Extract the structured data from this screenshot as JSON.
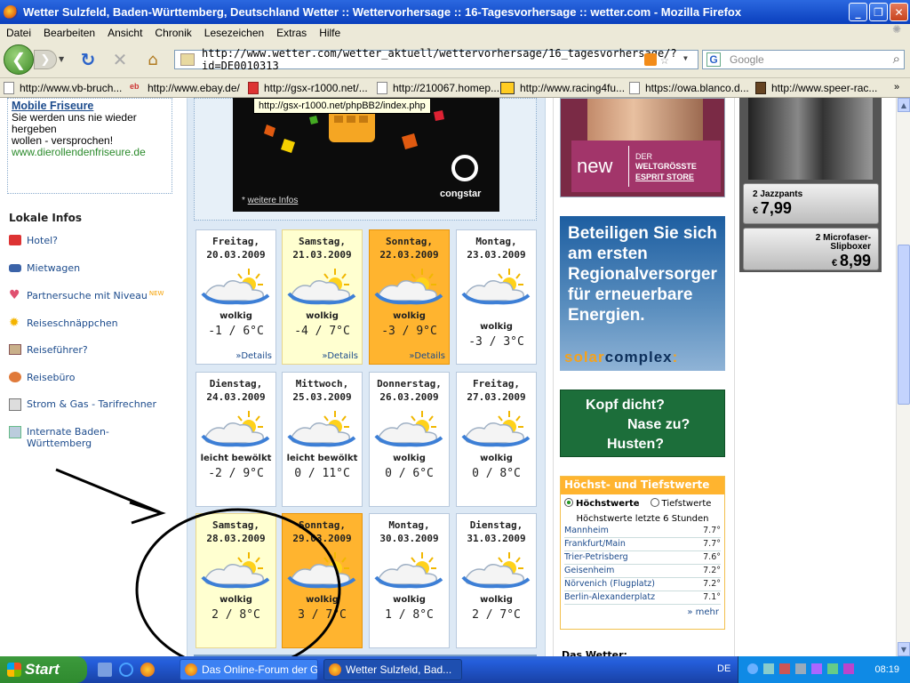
{
  "window": {
    "title": "Wetter Sulzfeld, Baden-Württemberg, Deutschland Wetter :: Wettervorhersage :: 16-Tagesvorhersage :: wetter.com - Mozilla Firefox"
  },
  "menu": [
    "Datei",
    "Bearbeiten",
    "Ansicht",
    "Chronik",
    "Lesezeichen",
    "Extras",
    "Hilfe"
  ],
  "nav": {
    "url": "http://www.wetter.com/wetter_aktuell/wettervorhersage/16_tagesvorhersage/?id=DE0010313",
    "search_placeholder": "Google"
  },
  "bookmarks": [
    "http://www.vb-bruch...",
    "http://www.ebay.de/",
    "http://gsx-r1000.net/...",
    "http://210067.homep...",
    "http://www.racing4fu...",
    "https://owa.blanco.d...",
    "http://www.speer-rac..."
  ],
  "tooltip": "http://gsx-r1000.net/phpBB2/index.php",
  "left": {
    "box": {
      "heading": "Mobile Friseure",
      "line1": "Sie werden uns nie wieder",
      "line2": "hergeben",
      "line3": "wollen - versprochen!",
      "url": "www.dierollendenfriseure.de"
    },
    "section_title": "Lokale Infos",
    "links": [
      {
        "label": "Hotel?",
        "icon": "hotel-icon",
        "color": "#d33"
      },
      {
        "label": "Mietwagen",
        "icon": "car-icon",
        "color": "#1c4b8c"
      },
      {
        "label": "Partnersuche mit Niveau",
        "icon": "heart-icon",
        "color": "#e05070",
        "badge": "NEW"
      },
      {
        "label": "Reiseschnäppchen",
        "icon": "sun-icon",
        "color": "#f4b400"
      },
      {
        "label": "Reiseführer?",
        "icon": "book-icon",
        "color": "#855"
      },
      {
        "label": "Reisebüro",
        "icon": "globe-icon",
        "color": "#d85"
      },
      {
        "label": "Strom & Gas - Tarifrechner",
        "icon": "calculator-icon",
        "color": "#777"
      },
      {
        "label": "Internate Baden-Württemberg",
        "icon": "school-icon",
        "color": "#6b8"
      }
    ]
  },
  "ad": {
    "brand": "congstar",
    "link_prefix": "* ",
    "link": "weitere Infos"
  },
  "forecast": [
    {
      "day": "Freitag,",
      "date": "20.03.2009",
      "cond": "wolkig",
      "temp": "-1 / 6°C",
      "details": "»Details",
      "style": "w"
    },
    {
      "day": "Samstag,",
      "date": "21.03.2009",
      "cond": "wolkig",
      "temp": "-4 / 7°C",
      "details": "»Details",
      "style": "y"
    },
    {
      "day": "Sonntag,",
      "date": "22.03.2009",
      "cond": "wolkig",
      "temp": "-3 / 9°C",
      "details": "»Details",
      "style": "o"
    },
    {
      "day": "Montag,",
      "date": "23.03.2009",
      "cond": "wolkig",
      "temp": "-3 / 3°C",
      "details": "",
      "style": "w"
    },
    {
      "day": "Dienstag,",
      "date": "24.03.2009",
      "cond": "leicht bewölkt",
      "temp": "-2 / 9°C",
      "details": "",
      "style": "w"
    },
    {
      "day": "Mittwoch,",
      "date": "25.03.2009",
      "cond": "leicht bewölkt",
      "temp": "0 / 11°C",
      "details": "",
      "style": "w"
    },
    {
      "day": "Donnerstag,",
      "date": "26.03.2009",
      "cond": "wolkig",
      "temp": "0 / 6°C",
      "details": "",
      "style": "w"
    },
    {
      "day": "Freitag,",
      "date": "27.03.2009",
      "cond": "wolkig",
      "temp": "0 / 8°C",
      "details": "",
      "style": "w"
    },
    {
      "day": "Samstag,",
      "date": "28.03.2009",
      "cond": "wolkig",
      "temp": "2 / 8°C",
      "details": "",
      "style": "y"
    },
    {
      "day": "Sonntag,",
      "date": "29.03.2009",
      "cond": "wolkig",
      "temp": "3 / 7°C",
      "details": "",
      "style": "o"
    },
    {
      "day": "Montag,",
      "date": "30.03.2009",
      "cond": "wolkig",
      "temp": "1 / 8°C",
      "details": "",
      "style": "w"
    },
    {
      "day": "Dienstag,",
      "date": "31.03.2009",
      "cond": "wolkig",
      "temp": "2 / 7°C",
      "details": "",
      "style": "w"
    }
  ],
  "right_ads": {
    "esprit": {
      "new": "new",
      "line1": "DER",
      "line2": "WELTGRÖSSTE",
      "line3": "ESPRIT STORE"
    },
    "solar": {
      "line1": "Beteiligen Sie sich",
      "line2": "am ersten",
      "line3": "Regionalversorger",
      "line4": "für erneuerbare",
      "line5": "Energien.",
      "brand_a": "solar",
      "brand_b": "complex"
    },
    "kopf": {
      "line1": "Kopf dicht?",
      "line2": "Nase zu?",
      "line3": "Husten?"
    }
  },
  "hoechst": {
    "title": "Höchst- und Tiefstwerte",
    "radio_hoechst": "Höchstwerte",
    "radio_tiefst": "Tiefstwerte",
    "subtitle": "Höchstwerte letzte 6 Stunden",
    "rows": [
      {
        "city": "Mannheim",
        "value": "7.7°"
      },
      {
        "city": "Frankfurt/Main",
        "value": "7.7°"
      },
      {
        "city": "Trier-Petrisberg",
        "value": "7.6°"
      },
      {
        "city": "Geisenheim",
        "value": "7.2°"
      },
      {
        "city": "Nörvenich (Flugplatz)",
        "value": "7.2°"
      },
      {
        "city": "Berlin-Alexanderplatz",
        "value": "7.1°"
      }
    ],
    "more": "» mehr"
  },
  "das_wetter": "Das Wetter:",
  "far_ad": {
    "item1": "2 Jazzpants",
    "price1": "7,99",
    "item2": "2 Microfaser-",
    "item2b": "Slipboxer",
    "price2": "8,99",
    "currency": "€"
  },
  "taskbar": {
    "start": "Start",
    "task1": "Das Online-Forum der GSX...",
    "task2": "Wetter Sulzfeld, Bad...",
    "lang": "DE",
    "time": "08:19"
  }
}
